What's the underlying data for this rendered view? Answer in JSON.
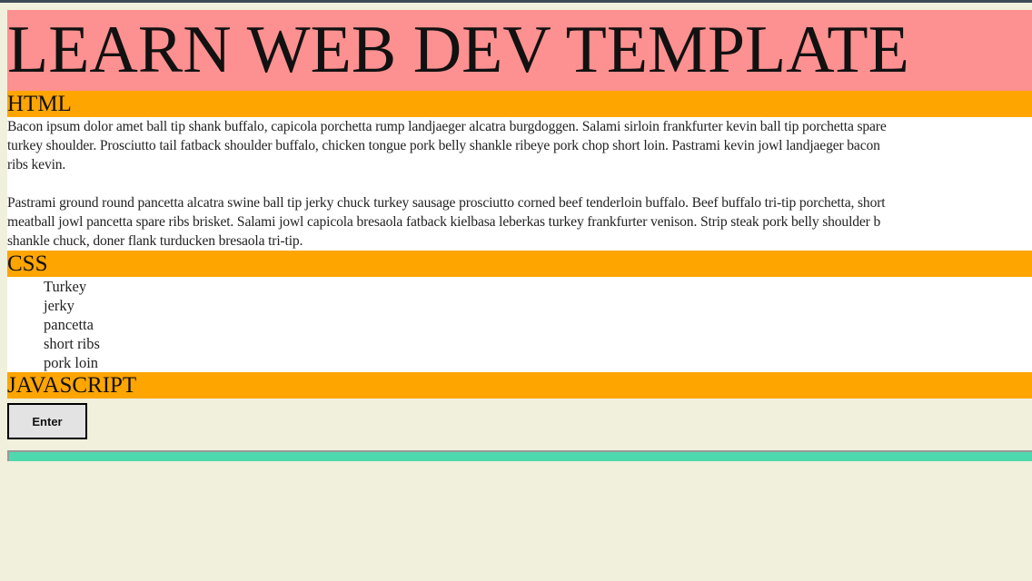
{
  "header": {
    "title": "LEARN WEB DEV TEMPLATE"
  },
  "sections": {
    "html": {
      "title": "HTML",
      "lines": [
        "Bacon ipsum dolor amet ball tip shank buffalo, capicola porchetta rump landjaeger alcatra burgdoggen. Salami sirloin frankfurter kevin ball tip porchetta spare",
        "turkey shoulder. Prosciutto tail fatback shoulder buffalo, chicken tongue pork belly shankle ribeye pork chop short loin. Pastrami kevin jowl landjaeger bacon",
        "ribs kevin.",
        "Pastrami ground round pancetta alcatra swine ball tip jerky chuck turkey sausage prosciutto corned beef tenderloin buffalo. Beef buffalo tri-tip porchetta, short",
        "meatball jowl pancetta spare ribs brisket. Salami jowl capicola bresaola fatback kielbasa leberkas turkey frankfurter venison. Strip steak pork belly shoulder b",
        "shankle chuck, doner flank turducken bresaola tri-tip."
      ]
    },
    "css": {
      "title": "CSS",
      "items": [
        "Turkey",
        "jerky",
        "pancetta",
        "short ribs",
        "pork loin"
      ]
    },
    "javascript": {
      "title": "JAVASCRIPT",
      "button_label": "Enter"
    }
  },
  "colors": {
    "header": "#fd9090",
    "section_bar": "#ffa500",
    "footer_bar": "#4dd9ad",
    "background": "#f0f0dc"
  }
}
